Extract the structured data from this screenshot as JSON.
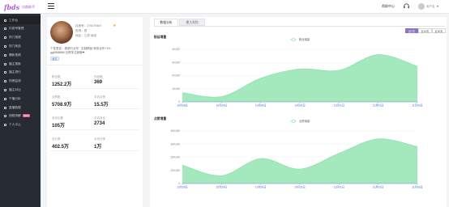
{
  "header": {
    "brand": "fbds",
    "brand_sub": "抖商助手",
    "help_label": "帮助中心",
    "user_name": "用户名"
  },
  "sidebar": {
    "items": [
      {
        "label": "工作台",
        "icon": "desktop-icon"
      },
      {
        "label": "抖音号管理",
        "icon": "account-icon"
      },
      {
        "label": "热门视频",
        "icon": "video-icon"
      },
      {
        "label": "热门商品",
        "icon": "goods-icon"
      },
      {
        "label": "爆款视频",
        "icon": "flame-icon"
      },
      {
        "label": "播主搜索",
        "icon": "search-icon"
      },
      {
        "label": "播主排行",
        "icon": "rank-icon"
      },
      {
        "label": "热榜监测",
        "icon": "monitor-icon"
      },
      {
        "label": "播主对比",
        "icon": "compare-icon"
      },
      {
        "label": "千播分析",
        "icon": "analysis-icon"
      },
      {
        "label": "直播数据",
        "icon": "live-icon"
      },
      {
        "label": "视频拆解",
        "icon": "scissor-icon",
        "badge": "NEW"
      },
      {
        "label": "个人中心",
        "icon": "user-icon"
      }
    ]
  },
  "profile": {
    "douyin_id": "抖音号：279279467",
    "gender": "性别：男",
    "region": "地区：江苏·南京",
    "bio_line1": "个性签名：视频行业号 · 定制精品·商务合作+VX：",
    "bio_line2": "gg8888888 记得关注我哦❤",
    "tag": "教育",
    "stats": [
      {
        "label": "粉丝数",
        "value": "1252.2万"
      },
      {
        "label": "作品数",
        "value": "369"
      },
      {
        "label": "点赞数",
        "value": "5708.9万"
      },
      {
        "label": "平均点赞",
        "value": "15.5万"
      },
      {
        "label": "总评论数",
        "value": "105万"
      },
      {
        "label": "平均评论",
        "value": "2734"
      },
      {
        "label": "总分享",
        "value": "402.5万"
      },
      {
        "label": "平均分享",
        "value": "1万"
      }
    ]
  },
  "panel": {
    "tabs": [
      "数据分析",
      "播主视频"
    ],
    "range_buttons": [
      "近7天",
      "近15天",
      "近30天"
    ]
  },
  "chart_data": [
    {
      "type": "area",
      "title": "粉丝增量",
      "legend": "粉丝增量",
      "x": [
        "10月28日",
        "10月29日",
        "10月30日",
        "10月31日",
        "11月01日",
        "11月02日",
        "11月03日"
      ],
      "series": [
        {
          "name": "粉丝增量",
          "values": [
            7000,
            4000,
            18000,
            25000,
            24000,
            36000,
            27000
          ]
        }
      ],
      "yticks": [
        0,
        10000,
        20000,
        30000,
        40000
      ],
      "ylim": [
        0,
        40000
      ],
      "color": "#a3e9bd",
      "line_color": "#8fe0ad"
    },
    {
      "type": "area",
      "title": "点赞增量",
      "legend": "点赞增量",
      "x": [
        "10月28日",
        "10月29日",
        "10月30日",
        "10月31日",
        "11月01日",
        "11月02日",
        "11月03日"
      ],
      "series": [
        {
          "name": "点赞增量",
          "values": [
            140000,
            60000,
            190000,
            110000,
            230000,
            340000,
            280000
          ]
        }
      ],
      "yticks": [
        0,
        100000,
        200000,
        300000,
        400000
      ],
      "ylim": [
        0,
        400000
      ],
      "color": "#a3e9bd",
      "line_color": "#8fe0ad"
    }
  ]
}
